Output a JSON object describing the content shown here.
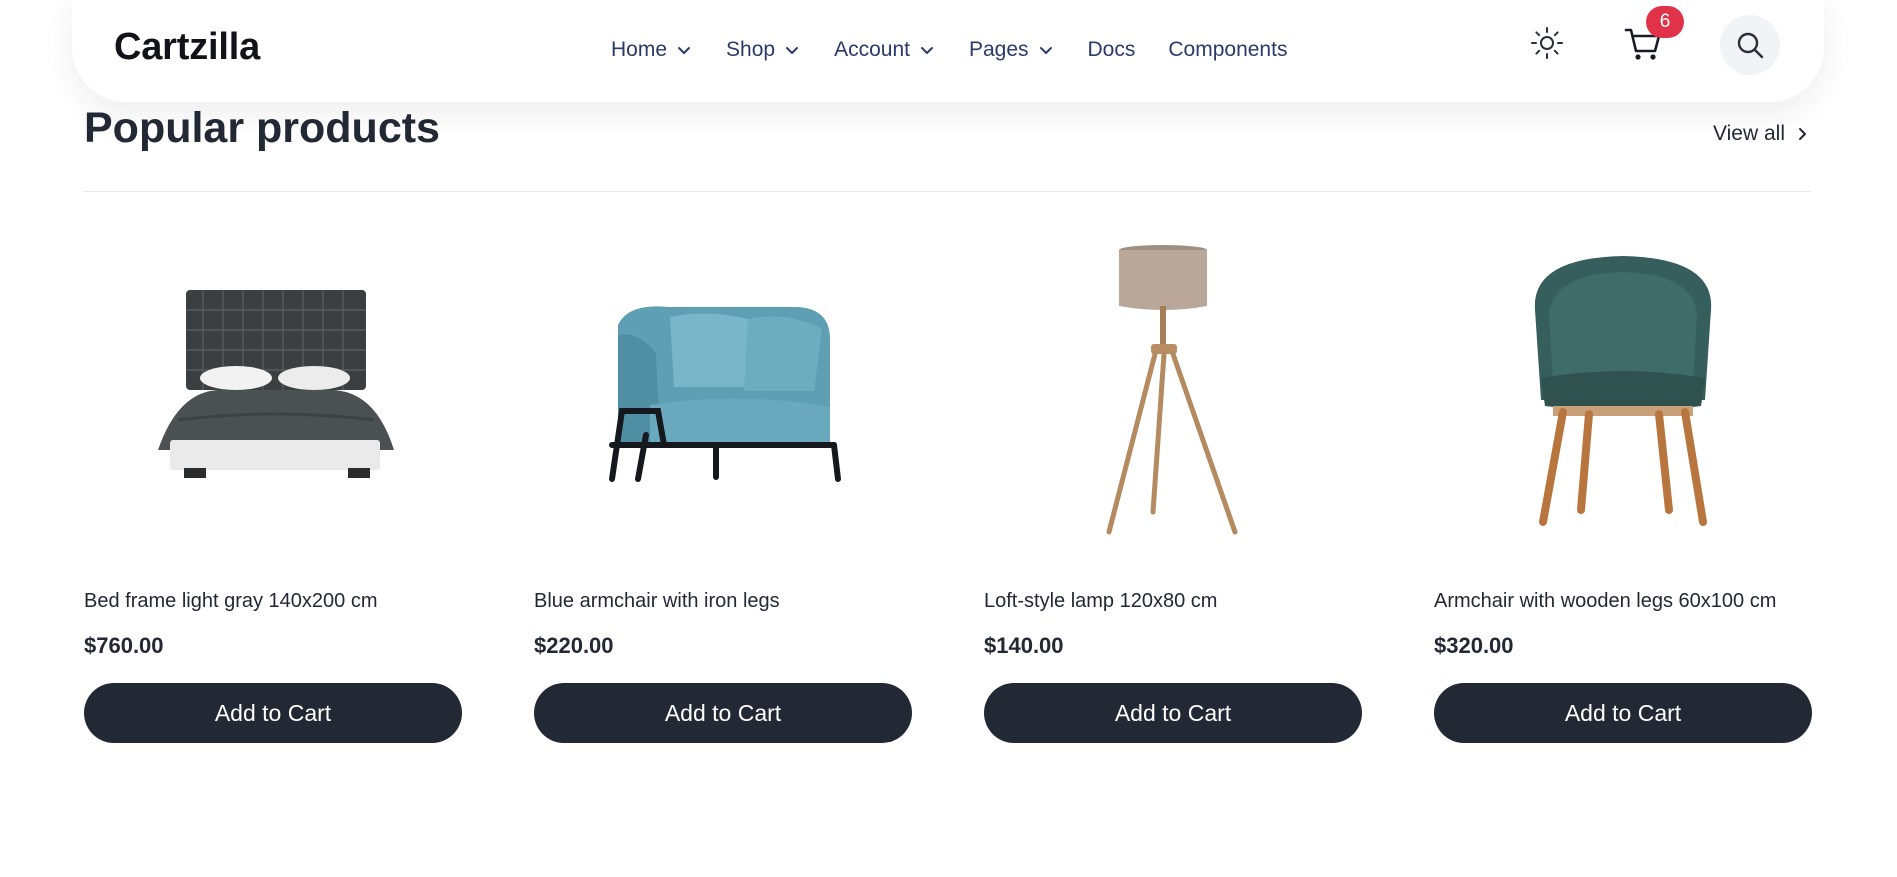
{
  "header": {
    "brand": "Cartzilla",
    "nav": [
      {
        "label": "Home",
        "icon": "chevron-down-icon"
      },
      {
        "label": "Shop",
        "icon": "chevron-down-icon"
      },
      {
        "label": "Account",
        "icon": "chevron-down-icon"
      },
      {
        "label": "Pages",
        "icon": "chevron-down-icon"
      },
      {
        "label": "Docs"
      },
      {
        "label": "Components"
      }
    ],
    "theme_icon": "sun-icon",
    "cart_icon": "cart-icon",
    "cart_count": "6",
    "search_icon": "search-icon"
  },
  "section": {
    "title": "Popular products",
    "view_all": "View all"
  },
  "products": [
    {
      "name": "Bed frame light gray 140x200 cm",
      "price": "$760.00",
      "button": "Add to Cart",
      "image": "bed-image"
    },
    {
      "name": "Blue armchair with iron legs",
      "price": "$220.00",
      "button": "Add to Cart",
      "image": "blue-armchair-image"
    },
    {
      "name": "Loft-style lamp 120x80 cm",
      "price": "$140.00",
      "button": "Add to Cart",
      "image": "floor-lamp-image"
    },
    {
      "name": "Armchair with wooden legs 60x100 cm",
      "price": "$320.00",
      "button": "Add to Cart",
      "image": "green-armchair-image"
    }
  ],
  "colors": {
    "nav_link": "#2b3a6b",
    "button_bg": "#222934",
    "badge": "#e0334a"
  }
}
